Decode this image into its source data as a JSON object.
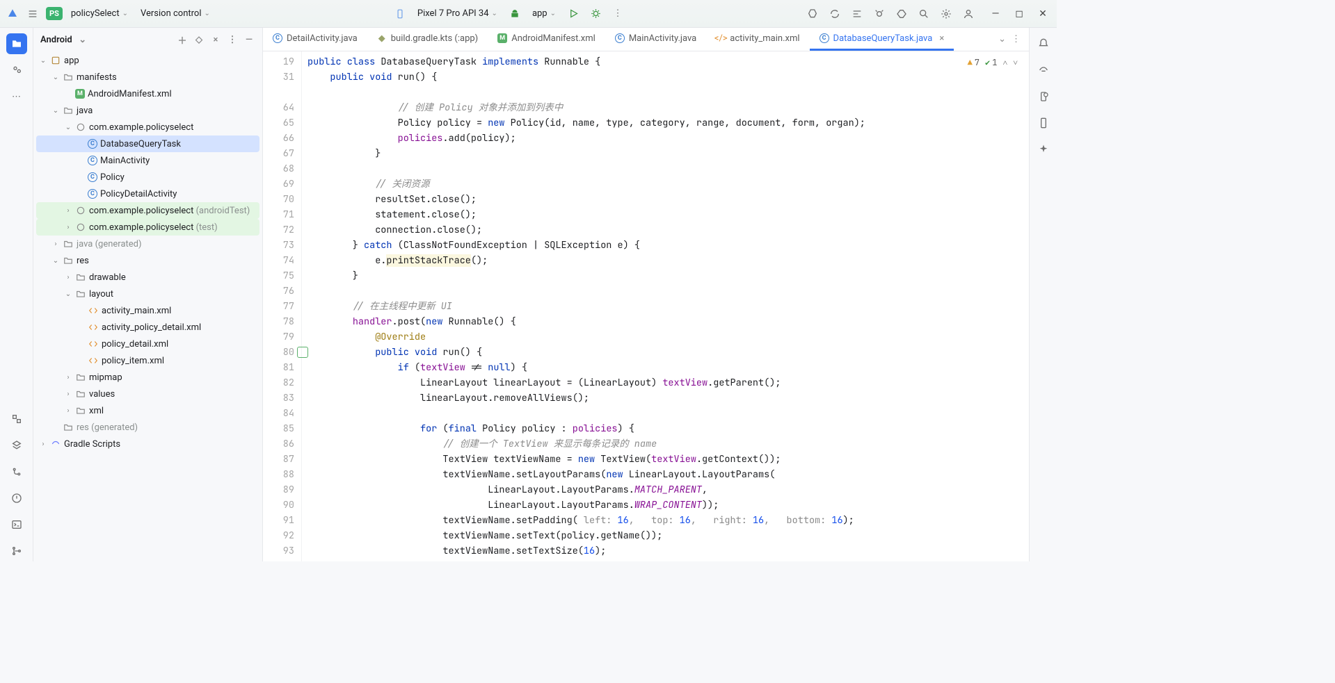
{
  "titlebar": {
    "project_badge": "PS",
    "project_name": "policySelect",
    "version_control": "Version control",
    "device": "Pixel 7 Pro API 34",
    "run_config": "app"
  },
  "sidebar": {
    "title": "Android",
    "nodes": [
      {
        "depth": 0,
        "arrow": "v",
        "icon": "mod",
        "label": "app",
        "interact": true
      },
      {
        "depth": 1,
        "arrow": "v",
        "icon": "folder",
        "label": "manifests",
        "interact": true
      },
      {
        "depth": 2,
        "arrow": "",
        "icon": "manifest",
        "label": "AndroidManifest.xml",
        "interact": true
      },
      {
        "depth": 1,
        "arrow": "v",
        "icon": "folder",
        "label": "java",
        "interact": true
      },
      {
        "depth": 2,
        "arrow": "v",
        "icon": "pkg",
        "label": "com.example.policyselect",
        "interact": true
      },
      {
        "depth": 3,
        "arrow": "",
        "icon": "cls",
        "label": "DatabaseQueryTask",
        "interact": true,
        "selected": true
      },
      {
        "depth": 3,
        "arrow": "",
        "icon": "cls",
        "label": "MainActivity",
        "interact": true
      },
      {
        "depth": 3,
        "arrow": "",
        "icon": "cls",
        "label": "Policy",
        "interact": true
      },
      {
        "depth": 3,
        "arrow": "",
        "icon": "cls",
        "label": "PolicyDetailActivity",
        "interact": true
      },
      {
        "depth": 2,
        "arrow": ">",
        "icon": "pkg",
        "label": "com.example.policyselect",
        "suffix": "(androidTest)",
        "interact": true,
        "test": true
      },
      {
        "depth": 2,
        "arrow": ">",
        "icon": "pkg",
        "label": "com.example.policyselect",
        "suffix": "(test)",
        "interact": true,
        "test": true
      },
      {
        "depth": 1,
        "arrow": ">",
        "icon": "folder",
        "label": "java",
        "suffix": "(generated)",
        "dim": true,
        "interact": true
      },
      {
        "depth": 1,
        "arrow": "v",
        "icon": "folder",
        "label": "res",
        "interact": true
      },
      {
        "depth": 2,
        "arrow": ">",
        "icon": "folder",
        "label": "drawable",
        "interact": true
      },
      {
        "depth": 2,
        "arrow": "v",
        "icon": "folder",
        "label": "layout",
        "interact": true
      },
      {
        "depth": 3,
        "arrow": "",
        "icon": "xml",
        "label": "activity_main.xml",
        "interact": true
      },
      {
        "depth": 3,
        "arrow": "",
        "icon": "xml",
        "label": "activity_policy_detail.xml",
        "interact": true
      },
      {
        "depth": 3,
        "arrow": "",
        "icon": "xml",
        "label": "policy_detail.xml",
        "interact": true
      },
      {
        "depth": 3,
        "arrow": "",
        "icon": "xml",
        "label": "policy_item.xml",
        "interact": true
      },
      {
        "depth": 2,
        "arrow": ">",
        "icon": "folder",
        "label": "mipmap",
        "interact": true
      },
      {
        "depth": 2,
        "arrow": ">",
        "icon": "folder",
        "label": "values",
        "interact": true
      },
      {
        "depth": 2,
        "arrow": ">",
        "icon": "folder",
        "label": "xml",
        "interact": true
      },
      {
        "depth": 1,
        "arrow": "",
        "icon": "folder",
        "label": "res",
        "suffix": "(generated)",
        "dim": true,
        "interact": true
      },
      {
        "depth": 0,
        "arrow": ">",
        "icon": "grad",
        "label": "Gradle Scripts",
        "interact": true
      }
    ]
  },
  "tabs": [
    {
      "icon": "cls",
      "label": "DetailActivity.java",
      "active": false
    },
    {
      "icon": "gradle",
      "label": "build.gradle.kts (:app)",
      "active": false
    },
    {
      "icon": "manifest",
      "label": "AndroidManifest.xml",
      "active": false
    },
    {
      "icon": "cls",
      "label": "MainActivity.java",
      "active": false
    },
    {
      "icon": "xml",
      "label": "activity_main.xml",
      "active": false
    },
    {
      "icon": "cls",
      "label": "DatabaseQueryTask.java",
      "active": true,
      "closeable": true
    }
  ],
  "inspector": {
    "warn": "7",
    "ok": "1"
  },
  "gutter": [
    "19",
    "31",
    "",
    "64",
    "65",
    "66",
    "67",
    "68",
    "69",
    "70",
    "71",
    "72",
    "73",
    "74",
    "75",
    "76",
    "77",
    "78",
    "79",
    "80",
    "81",
    "82",
    "83",
    "84",
    "85",
    "86",
    "87",
    "88",
    "89",
    "90",
    "91",
    "92",
    "93"
  ],
  "gutter_override_row": 19,
  "code": {
    "l0": {
      "a": "public class ",
      "b": "DatabaseQueryTask ",
      "c": "implements ",
      "d": "Runnable {"
    },
    "l1": {
      "a": "    public void ",
      "b": "run",
      "c": "() {"
    },
    "l2": "",
    "l3": {
      "a": "                // ",
      "b": "创建 Policy 对象并添加到列表中"
    },
    "l4": {
      "a": "                Policy policy = ",
      "b": "new ",
      "c": "Policy(id, name, type, category, range, document, form, organ);"
    },
    "l5": {
      "a": "                ",
      "b": "policies",
      "c": ".add(policy);"
    },
    "l6": "            }",
    "l7": "",
    "l8": {
      "a": "            // ",
      "b": "关闭资源"
    },
    "l9": "            resultSet.close();",
    "l10": "            statement.close();",
    "l11": "            connection.close();",
    "l12": {
      "a": "        } ",
      "b": "catch ",
      "c": "(ClassNotFoundException | SQLException e) {"
    },
    "l13": {
      "a": "            e.",
      "b": "printStackTrace",
      "c": "();"
    },
    "l14": "        }",
    "l15": "",
    "l16": {
      "a": "        // ",
      "b": "在主线程中更新 UI"
    },
    "l17": {
      "a": "        ",
      "b": "handler",
      "c": ".post(",
      "d": "new ",
      "e": "Runnable() {"
    },
    "l18": {
      "a": "            ",
      "b": "@Override"
    },
    "l19": {
      "a": "            ",
      "b": "public void ",
      "c": "run",
      "d": "() {"
    },
    "l20": {
      "a": "                ",
      "b": "if ",
      "c": "(",
      "d": "textView ",
      "e": "!= ",
      "f": "null",
      "g": ") {"
    },
    "l21": {
      "a": "                    LinearLayout linearLayout = (LinearLayout) ",
      "b": "textView",
      "c": ".getParent();"
    },
    "l22": "                    linearLayout.removeAllViews();",
    "l23": "",
    "l24": {
      "a": "                    ",
      "b": "for ",
      "c": "(",
      "d": "final ",
      "e": "Policy policy : ",
      "f": "policies",
      "g": ") {"
    },
    "l25": {
      "a": "                        // ",
      "b": "创建一个 TextView 来显示每条记录的 name"
    },
    "l26": {
      "a": "                        TextView textViewName = ",
      "b": "new ",
      "c": "TextView(",
      "d": "textView",
      "e": ".getContext());"
    },
    "l27": {
      "a": "                        textViewName.setLayoutParams(",
      "b": "new ",
      "c": "LinearLayout.LayoutParams("
    },
    "l28": {
      "a": "                                LinearLayout.LayoutParams.",
      "b": "MATCH_PARENT",
      "c": ","
    },
    "l29": {
      "a": "                                LinearLayout.LayoutParams.",
      "b": "WRAP_CONTENT",
      "c": "));"
    },
    "l30": {
      "a": "                        textViewName.setPadding( ",
      "h1": "left: ",
      "n1": "16",
      "h2": ",   top: ",
      "n2": "16",
      "h3": ",   right: ",
      "n3": "16",
      "h4": ",   bottom: ",
      "n4": "16",
      "z": ");"
    },
    "l31": "                        textViewName.setText(policy.getName());",
    "l32": {
      "a": "                        textViewName.setTextSize(",
      "n": "16",
      "z": ");"
    }
  }
}
